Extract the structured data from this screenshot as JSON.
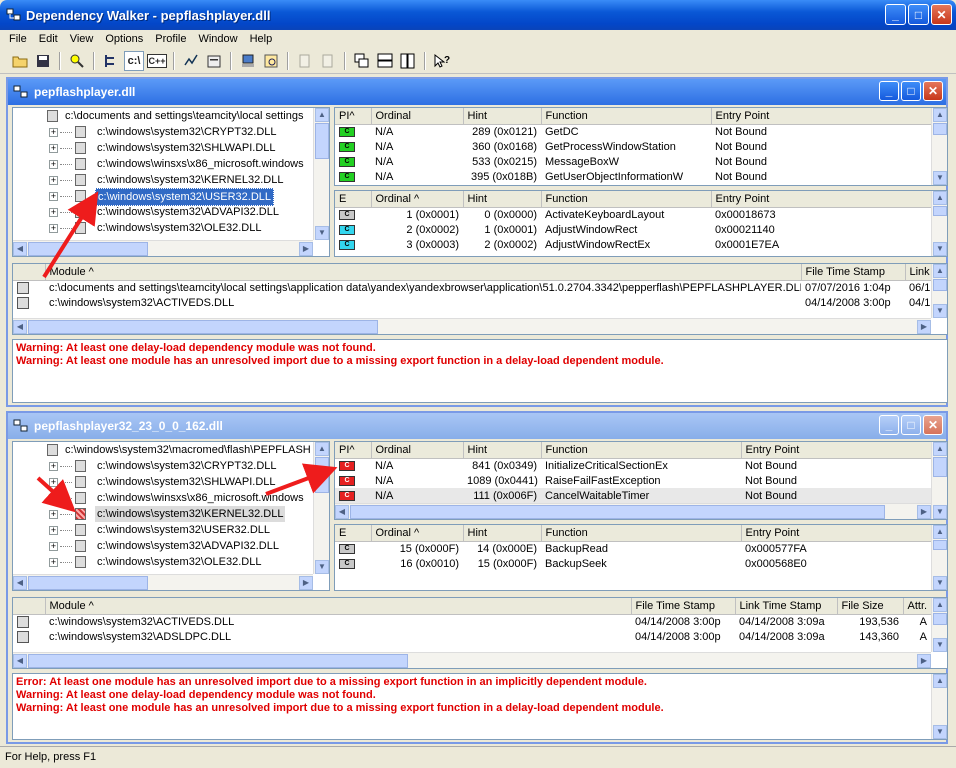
{
  "window": {
    "title": "Dependency Walker - pepflashplayer.dll"
  },
  "menu": [
    "File",
    "Edit",
    "View",
    "Options",
    "Profile",
    "Window",
    "Help"
  ],
  "toolbar_text": {
    "cpath": "c:\\",
    "cpp": "C++"
  },
  "doc1": {
    "title": "pepflashplayer.dll",
    "tree": [
      {
        "label": "c:\\documents and settings\\teamcity\\local settings",
        "level": 0
      },
      {
        "label": "c:\\windows\\system32\\CRYPT32.DLL",
        "level": 1
      },
      {
        "label": "c:\\windows\\system32\\SHLWAPI.DLL",
        "level": 1
      },
      {
        "label": "c:\\windows\\winsxs\\x86_microsoft.windows",
        "level": 1
      },
      {
        "label": "c:\\windows\\system32\\KERNEL32.DLL",
        "level": 1
      },
      {
        "label": "c:\\windows\\system32\\USER32.DLL",
        "level": 1,
        "selected": true
      },
      {
        "label": "c:\\windows\\system32\\ADVAPI32.DLL",
        "level": 1
      },
      {
        "label": "c:\\windows\\system32\\OLE32.DLL",
        "level": 1
      }
    ],
    "imports": {
      "headers": [
        "PI^",
        "Ordinal",
        "Hint",
        "Function",
        "Entry Point"
      ],
      "rows": [
        [
          "C",
          "N/A",
          "289 (0x0121)",
          "GetDC",
          "Not Bound"
        ],
        [
          "C",
          "N/A",
          "360 (0x0168)",
          "GetProcessWindowStation",
          "Not Bound"
        ],
        [
          "C",
          "N/A",
          "533 (0x0215)",
          "MessageBoxW",
          "Not Bound"
        ],
        [
          "C",
          "N/A",
          "395 (0x018B)",
          "GetUserObjectInformationW",
          "Not Bound"
        ]
      ]
    },
    "exports": {
      "headers": [
        "E",
        "Ordinal ^",
        "Hint",
        "Function",
        "Entry Point"
      ],
      "rows": [
        [
          "C",
          "1 (0x0001)",
          "0 (0x0000)",
          "ActivateKeyboardLayout",
          "0x00018673"
        ],
        [
          "C",
          "2 (0x0002)",
          "1 (0x0001)",
          "AdjustWindowRect",
          "0x00021140"
        ],
        [
          "C",
          "3 (0x0003)",
          "2 (0x0002)",
          "AdjustWindowRectEx",
          "0x0001E7EA"
        ]
      ]
    },
    "modules": {
      "headers": [
        "Module ^",
        "File Time Stamp",
        "Link"
      ],
      "rows": [
        [
          "c:\\documents and settings\\teamcity\\local settings\\application data\\yandex\\yandexbrowser\\application\\51.0.2704.3342\\pepperflash\\PEPFLASHPLAYER.DLL",
          "07/07/2016  1:04p",
          "06/1"
        ],
        [
          "c:\\windows\\system32\\ACTIVEDS.DLL",
          "04/14/2008  3:00p",
          "04/1"
        ]
      ]
    },
    "log": [
      "Warning: At least one delay-load dependency module was not found.",
      "Warning: At least one module has an unresolved import due to a missing export function in a delay-load dependent module."
    ]
  },
  "doc2": {
    "title": "pepflashplayer32_23_0_0_162.dll",
    "tree": [
      {
        "label": "c:\\windows\\system32\\macromed\\flash\\PEPFLASH",
        "level": 0
      },
      {
        "label": "c:\\windows\\system32\\CRYPT32.DLL",
        "level": 1
      },
      {
        "label": "c:\\windows\\system32\\SHLWAPI.DLL",
        "level": 1
      },
      {
        "label": "c:\\windows\\winsxs\\x86_microsoft.windows",
        "level": 1
      },
      {
        "label": "c:\\windows\\system32\\KERNEL32.DLL",
        "level": 1,
        "error": true,
        "highlight": true
      },
      {
        "label": "c:\\windows\\system32\\USER32.DLL",
        "level": 1
      },
      {
        "label": "c:\\windows\\system32\\ADVAPI32.DLL",
        "level": 1
      },
      {
        "label": "c:\\windows\\system32\\OLE32.DLL",
        "level": 1
      }
    ],
    "imports": {
      "headers": [
        "PI^",
        "Ordinal",
        "Hint",
        "Function",
        "Entry Point"
      ],
      "rows": [
        [
          "C",
          "N/A",
          "841 (0x0349)",
          "InitializeCriticalSectionEx",
          "Not Bound"
        ],
        [
          "C",
          "N/A",
          "1089 (0x0441)",
          "RaiseFailFastException",
          "Not Bound"
        ],
        [
          "C",
          "N/A",
          "111 (0x006F)",
          "CancelWaitableTimer",
          "Not Bound"
        ]
      ]
    },
    "exports": {
      "headers": [
        "E",
        "Ordinal ^",
        "Hint",
        "Function",
        "Entry Point"
      ],
      "rows": [
        [
          "C",
          "15 (0x000F)",
          "14 (0x000E)",
          "BackupRead",
          "0x000577FA"
        ],
        [
          "C",
          "16 (0x0010)",
          "15 (0x000F)",
          "BackupSeek",
          "0x000568E0"
        ]
      ]
    },
    "modules": {
      "headers": [
        "Module ^",
        "File Time Stamp",
        "Link Time Stamp",
        "File Size",
        "Attr."
      ],
      "rows": [
        [
          "c:\\windows\\system32\\ACTIVEDS.DLL",
          "04/14/2008  3:00p",
          "04/14/2008  3:09a",
          "193,536",
          "A"
        ],
        [
          "c:\\windows\\system32\\ADSLDPC.DLL",
          "04/14/2008  3:00p",
          "04/14/2008  3:09a",
          "143,360",
          "A"
        ]
      ]
    },
    "log": [
      {
        "text": "Error: At least one module has an unresolved import due to a missing export function in an implicitly dependent module.",
        "kind": "error"
      },
      {
        "text": "Warning: At least one delay-load dependency module was not found.",
        "kind": "warning"
      },
      {
        "text": "Warning: At least one module has an unresolved import due to a missing export function in a delay-load dependent module.",
        "kind": "warning"
      }
    ]
  },
  "status": {
    "text": "For Help, press F1"
  },
  "colors": {
    "title_active": "#0a58d6",
    "log_text": "#e00000",
    "selection": "#316ac5",
    "arrow": "#ee1c1c"
  }
}
